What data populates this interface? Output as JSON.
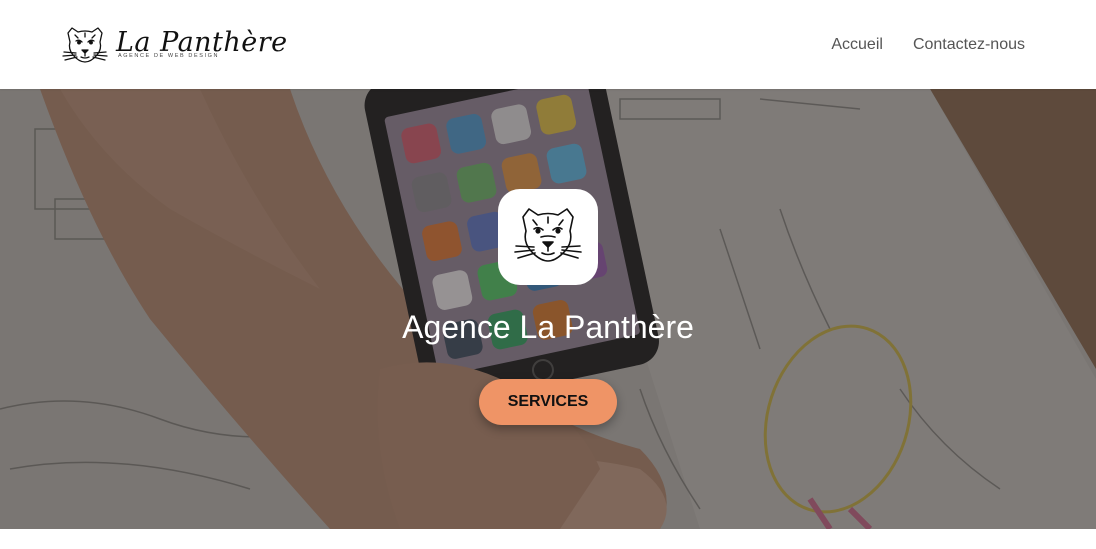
{
  "brand": {
    "name": "La Panthère",
    "tagline": "AGENCE DE WEB DESIGN",
    "icon": "panther-head-icon"
  },
  "nav": {
    "items": [
      {
        "label": "Accueil"
      },
      {
        "label": "Contactez-nous"
      }
    ]
  },
  "hero": {
    "title": "Agence La Panthère",
    "cta_label": "SERVICES",
    "logo_icon": "panther-head-icon",
    "background": "desk-with-phone-and-sketches-photo"
  },
  "colors": {
    "accent": "#ef9466",
    "nav_text": "#555555",
    "title_text": "#ffffff"
  }
}
